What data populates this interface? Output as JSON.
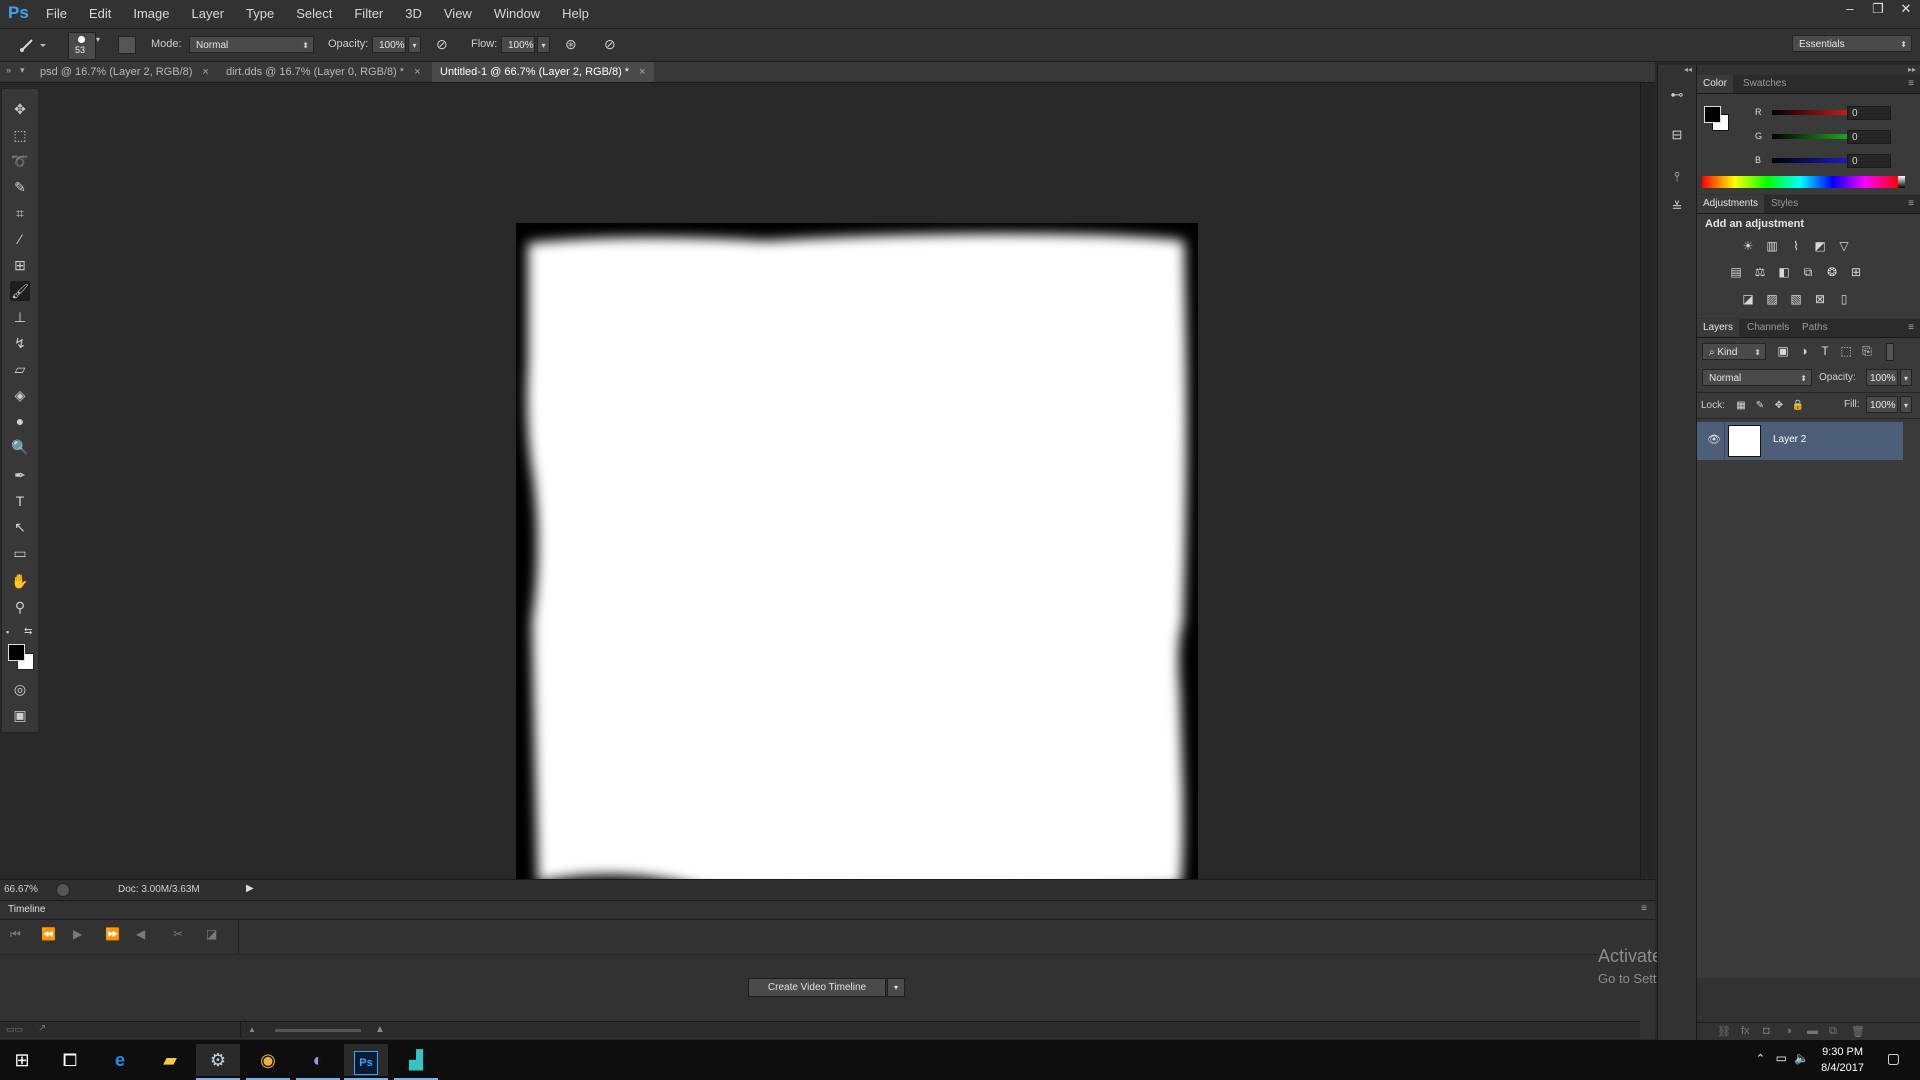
{
  "app": {
    "logo": "Ps"
  },
  "menubar": {
    "items": [
      "File",
      "Edit",
      "Image",
      "Layer",
      "Type",
      "Select",
      "Filter",
      "3D",
      "View",
      "Window",
      "Help"
    ]
  },
  "window_controls": {
    "minimize": "–",
    "restore": "❐",
    "close": "✕"
  },
  "options": {
    "brush_size": "53",
    "mode_label": "Mode:",
    "mode_value": "Normal",
    "opacity_label": "Opacity:",
    "opacity_value": "100%",
    "flow_label": "Flow:",
    "flow_value": "100%",
    "workspace": "Essentials"
  },
  "tabs": [
    {
      "label": "psd @ 16.7% (Layer 2, RGB/8)",
      "active": false
    },
    {
      "label": "dirt.dds @ 16.7% (Layer 0, RGB/8) *",
      "active": false
    },
    {
      "label": "Untitled-1 @ 66.7% (Layer 2, RGB/8) *",
      "active": true
    }
  ],
  "tools": [
    "move-icon",
    "marquee-icon",
    "lasso-icon",
    "quick-select-icon",
    "crop-icon",
    "eyedropper-icon",
    "healing-icon",
    "brush-icon",
    "stamp-icon",
    "history-brush-icon",
    "eraser-icon",
    "paint-bucket-icon",
    "blur-icon",
    "dodge-icon",
    "pen-icon",
    "type-icon",
    "path-select-icon",
    "rectangle-icon",
    "hand-icon",
    "zoom-icon"
  ],
  "status": {
    "zoom": "66.67%",
    "doc": "Doc: 3.00M/3.63M"
  },
  "timeline": {
    "title": "Timeline",
    "create_button": "Create Video Timeline"
  },
  "watermark": {
    "title": "Activate Windows",
    "subtitle": "Go to Settings to activate Windows."
  },
  "color_panel": {
    "tabs": [
      "Color",
      "Swatches"
    ],
    "channels": [
      {
        "name": "R",
        "value": "0",
        "color": "#e02020"
      },
      {
        "name": "G",
        "value": "0",
        "color": "#20c020"
      },
      {
        "name": "B",
        "value": "0",
        "color": "#2020e0"
      }
    ],
    "foreground": "#000000",
    "background": "#ffffff"
  },
  "adjustments_panel": {
    "tabs": [
      "Adjustments",
      "Styles"
    ],
    "title": "Add an adjustment"
  },
  "layers_panel": {
    "tabs": [
      "Layers",
      "Channels",
      "Paths"
    ],
    "filter_kind": "Kind",
    "blend_mode": "Normal",
    "opacity_label": "Opacity:",
    "opacity_value": "100%",
    "lock_label": "Lock:",
    "fill_label": "Fill:",
    "fill_value": "100%",
    "layers": [
      {
        "name": "Layer 2",
        "visible": true,
        "selected": true
      }
    ]
  },
  "taskbar": {
    "apps": [
      "windows-start-icon",
      "task-view-icon",
      "edge-icon",
      "file-explorer-icon",
      "steam-icon",
      "chrome-icon",
      "discord-icon",
      "photoshop-icon",
      "app-icon"
    ],
    "time": "9:30 PM",
    "date": "8/4/2017"
  }
}
